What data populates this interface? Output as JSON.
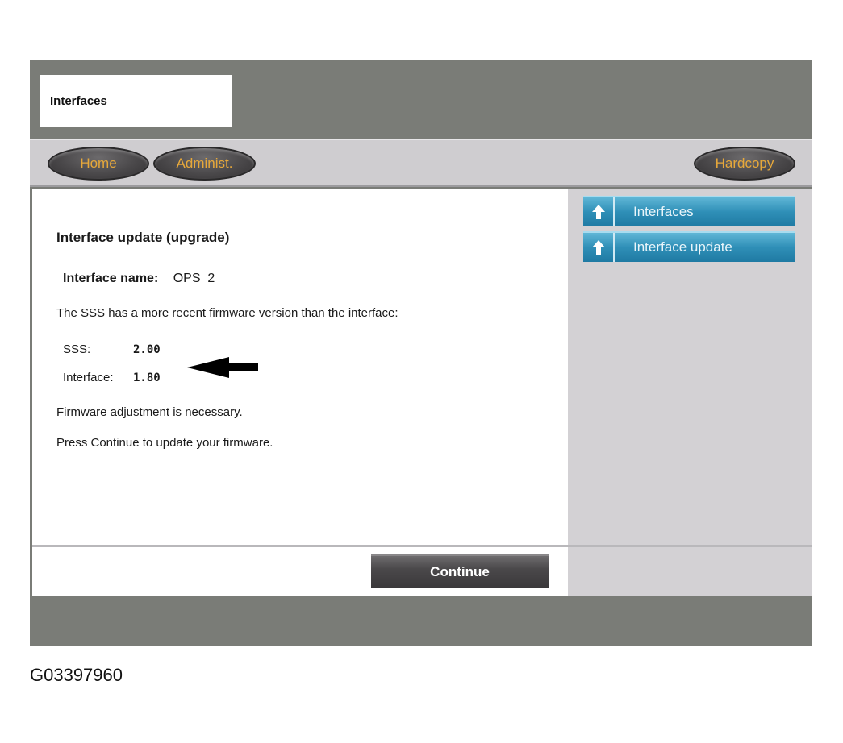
{
  "window": {
    "title": "Interfaces"
  },
  "nav": {
    "home": "Home",
    "admin": "Administ.",
    "hardcopy": "Hardcopy"
  },
  "main": {
    "heading": "Interface update (upgrade)",
    "name_label": "Interface name:",
    "name_value": "OPS_2",
    "message": "The SSS has a more recent firmware version than the interface:",
    "versions": [
      {
        "label": "SSS:",
        "value": "2.00"
      },
      {
        "label": "Interface:",
        "value": "1.80"
      }
    ],
    "adjust_note": "Firmware adjustment is necessary.",
    "instruction": "Press Continue to update your firmware.",
    "continue_label": "Continue"
  },
  "sidebar": {
    "items": [
      {
        "label": "Interfaces",
        "icon": "up-arrow-icon"
      },
      {
        "label": "Interface update",
        "icon": "up-arrow-icon"
      }
    ]
  },
  "caption": "G03397960",
  "colors": {
    "frame": "#7a7c77",
    "navbar": "#cfcdd0",
    "accent_text": "#e7a83a",
    "sidebar_button": "#2f8fb7"
  }
}
